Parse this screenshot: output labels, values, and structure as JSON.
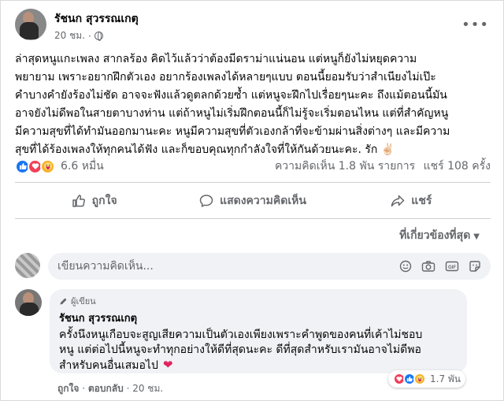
{
  "post": {
    "author": "รัชนก สุวรรณเกตุ",
    "time": "20 ชม.",
    "more_label": "•••",
    "lines": [
      "ล่าสุดหนูแกะเพลง สากลร้อง คิดไว้แล้วว่าต้องมีดราม่าแน่นอน แต่หนูก็ยังไม่หยุดความ",
      "พยายาม เพราะอยากฝึกตัวเอง อยากร้องเพลงได้หลายๆแบบ ตอนนี้ยอมรับว่าสำเนียงไม่เป๊ะ",
      "คำบางคำยังร้องไม่ชัด อาจจะฟังแล้วดูตลกด้วยซ้ำ แต่หนูจะฝึกไปเรื่อยๆนะคะ ถึงแม้ตอนนี้มัน",
      "อาจยังไม่ดีพอในสายตาบางท่าน แต่ถ้าหนูไม่เริ่มฝึกตอนนี้ก็ไม่รู้จะเริ่มตอนไหน แต่ที่สำคัญหนู",
      "มีความสุขที่ได้ทำมันออกมานะคะ หนูมีความสุขที่ตัวเองกล้าที่จะข้ามผ่านสิ่งต่างๆ และมีความ",
      "สุขที่ได้ร้องเพลงให้ทุกคนได้ฟัง และก็ขอบคุณทุกกำลังใจที่ให้กันด้วยนะคะ. รัก ✌🏻"
    ],
    "reaction_count": "6.6 หมื่น",
    "comments_count": "ความคิดเห็น 1.8 พัน รายการ",
    "shares_count": "แชร์ 108 ครั้ง"
  },
  "actions": {
    "like": "ถูกใจ",
    "comment": "แสดงความคิดเห็น",
    "share": "แชร์"
  },
  "sort_label": "ที่เกี่ยวข้องที่สุด",
  "comment_input": {
    "placeholder": "เขียนความคิดเห็น..."
  },
  "comment": {
    "badge": "ผู้เขียน",
    "author": "รัชนก สุวรรณเกตุ",
    "lines": [
      "ครั้งนึงหนูเกือบจะสูญเสียความเป็นตัวเองเพียงเพราะคำพูดของคนที่เค้าไม่ชอบ",
      "หนู แต่ต่อไปนี้หนูจะทำทุกอย่างให้ดีที่สุดนะคะ ดีที่สุดสำหรับเรามันอาจไม่ดีพอ",
      "สำหรับคนอื่นเสมอไป"
    ],
    "reaction_count": "1.7 พัน",
    "like": "ถูกใจ",
    "reply": "ตอบกลับ",
    "time": "20 ชม."
  },
  "colors": {
    "like_blue": "#1877f2",
    "love_red": "#f33e58",
    "care_yellow": "#f7b125",
    "secondary_text": "#65676b"
  },
  "icons": [
    "globe-icon",
    "more-icon",
    "like-icon",
    "love-icon",
    "care-icon",
    "thumb-up-icon",
    "comment-icon",
    "share-icon",
    "chevron-down-icon",
    "emoji-icon",
    "camera-icon",
    "gif-icon",
    "sticker-icon",
    "pen-icon",
    "heart-icon"
  ]
}
